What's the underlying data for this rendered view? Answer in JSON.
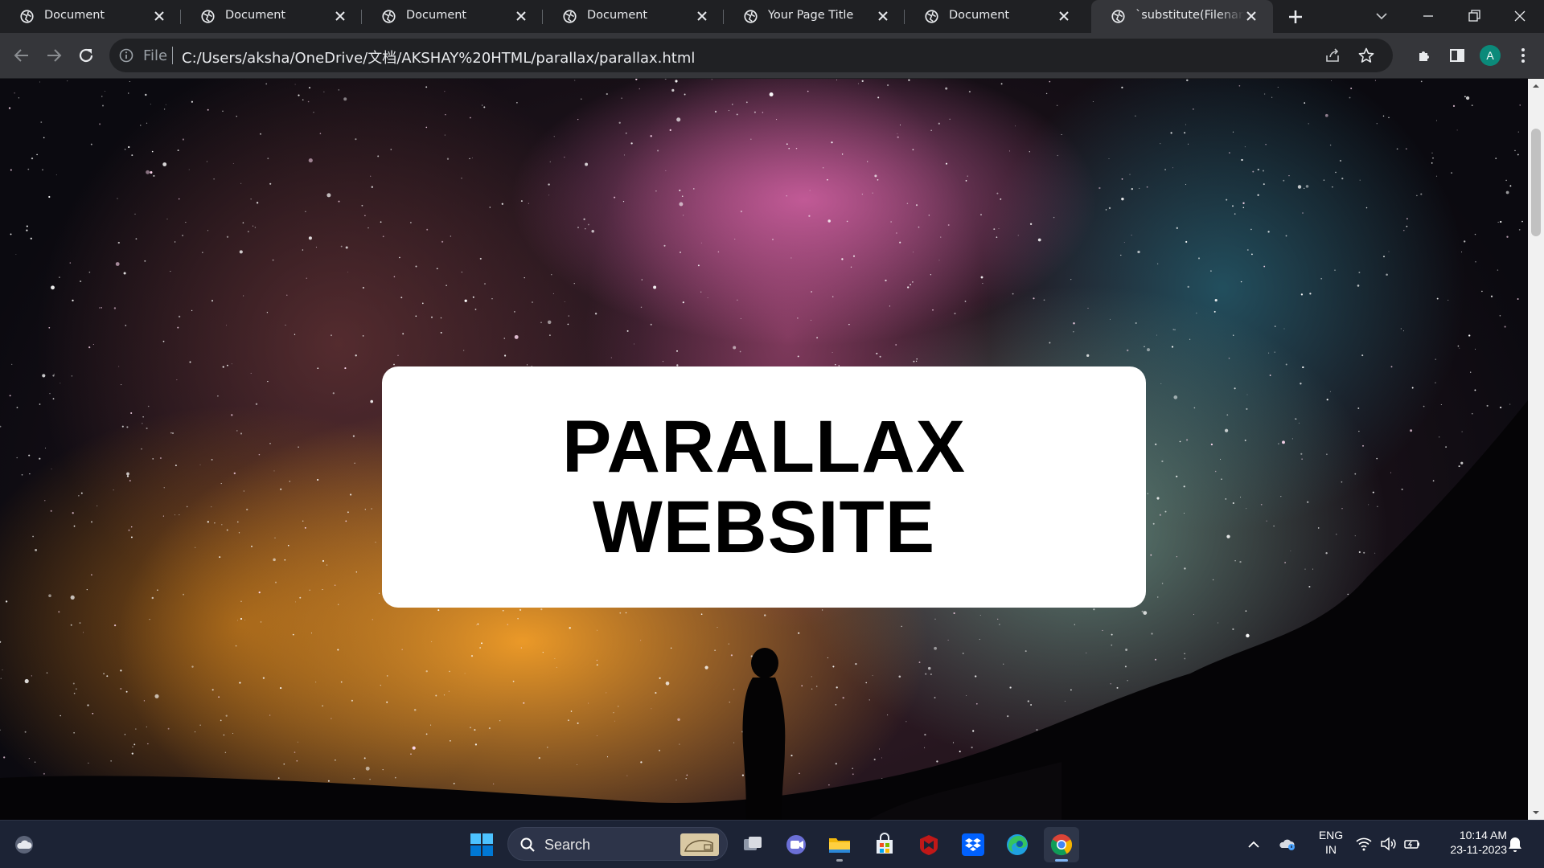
{
  "browser": {
    "tabs": [
      {
        "title": "Document",
        "active": false
      },
      {
        "title": "Document",
        "active": false
      },
      {
        "title": "Document",
        "active": false
      },
      {
        "title": "Document",
        "active": false
      },
      {
        "title": "Your Page Title",
        "active": false
      },
      {
        "title": "Document",
        "active": false
      },
      {
        "title": "`substitute(Filename(",
        "active": true
      }
    ],
    "address_bar": {
      "scheme_label": "File",
      "url": "C:/Users/aksha/OneDrive/文档/AKSHAY%20HTML/parallax/parallax.html"
    },
    "profile_initial": "A"
  },
  "page": {
    "hero": {
      "line1": "PARALLAX",
      "line2": "WEBSITE"
    },
    "background_icon": "starry-night-sky-with-silhouette"
  },
  "taskbar": {
    "search_label": "Search",
    "language": {
      "line1": "ENG",
      "line2": "IN"
    },
    "clock": {
      "time": "10:14 AM",
      "date": "23-11-2023"
    },
    "apps": [
      "windows-start-icon",
      "task-view-icon",
      "teams-icon",
      "file-explorer-icon",
      "microsoft-store-icon",
      "mcafee-icon",
      "dropbox-icon",
      "edge-icon",
      "chrome-icon"
    ]
  },
  "colors": {
    "tab_strip": "#1f2023",
    "toolbar": "#35363a",
    "omnibox": "#202124",
    "taskbar": "#1c2335",
    "hero_card": "#ffffff",
    "avatar": "#0b8a7a"
  }
}
